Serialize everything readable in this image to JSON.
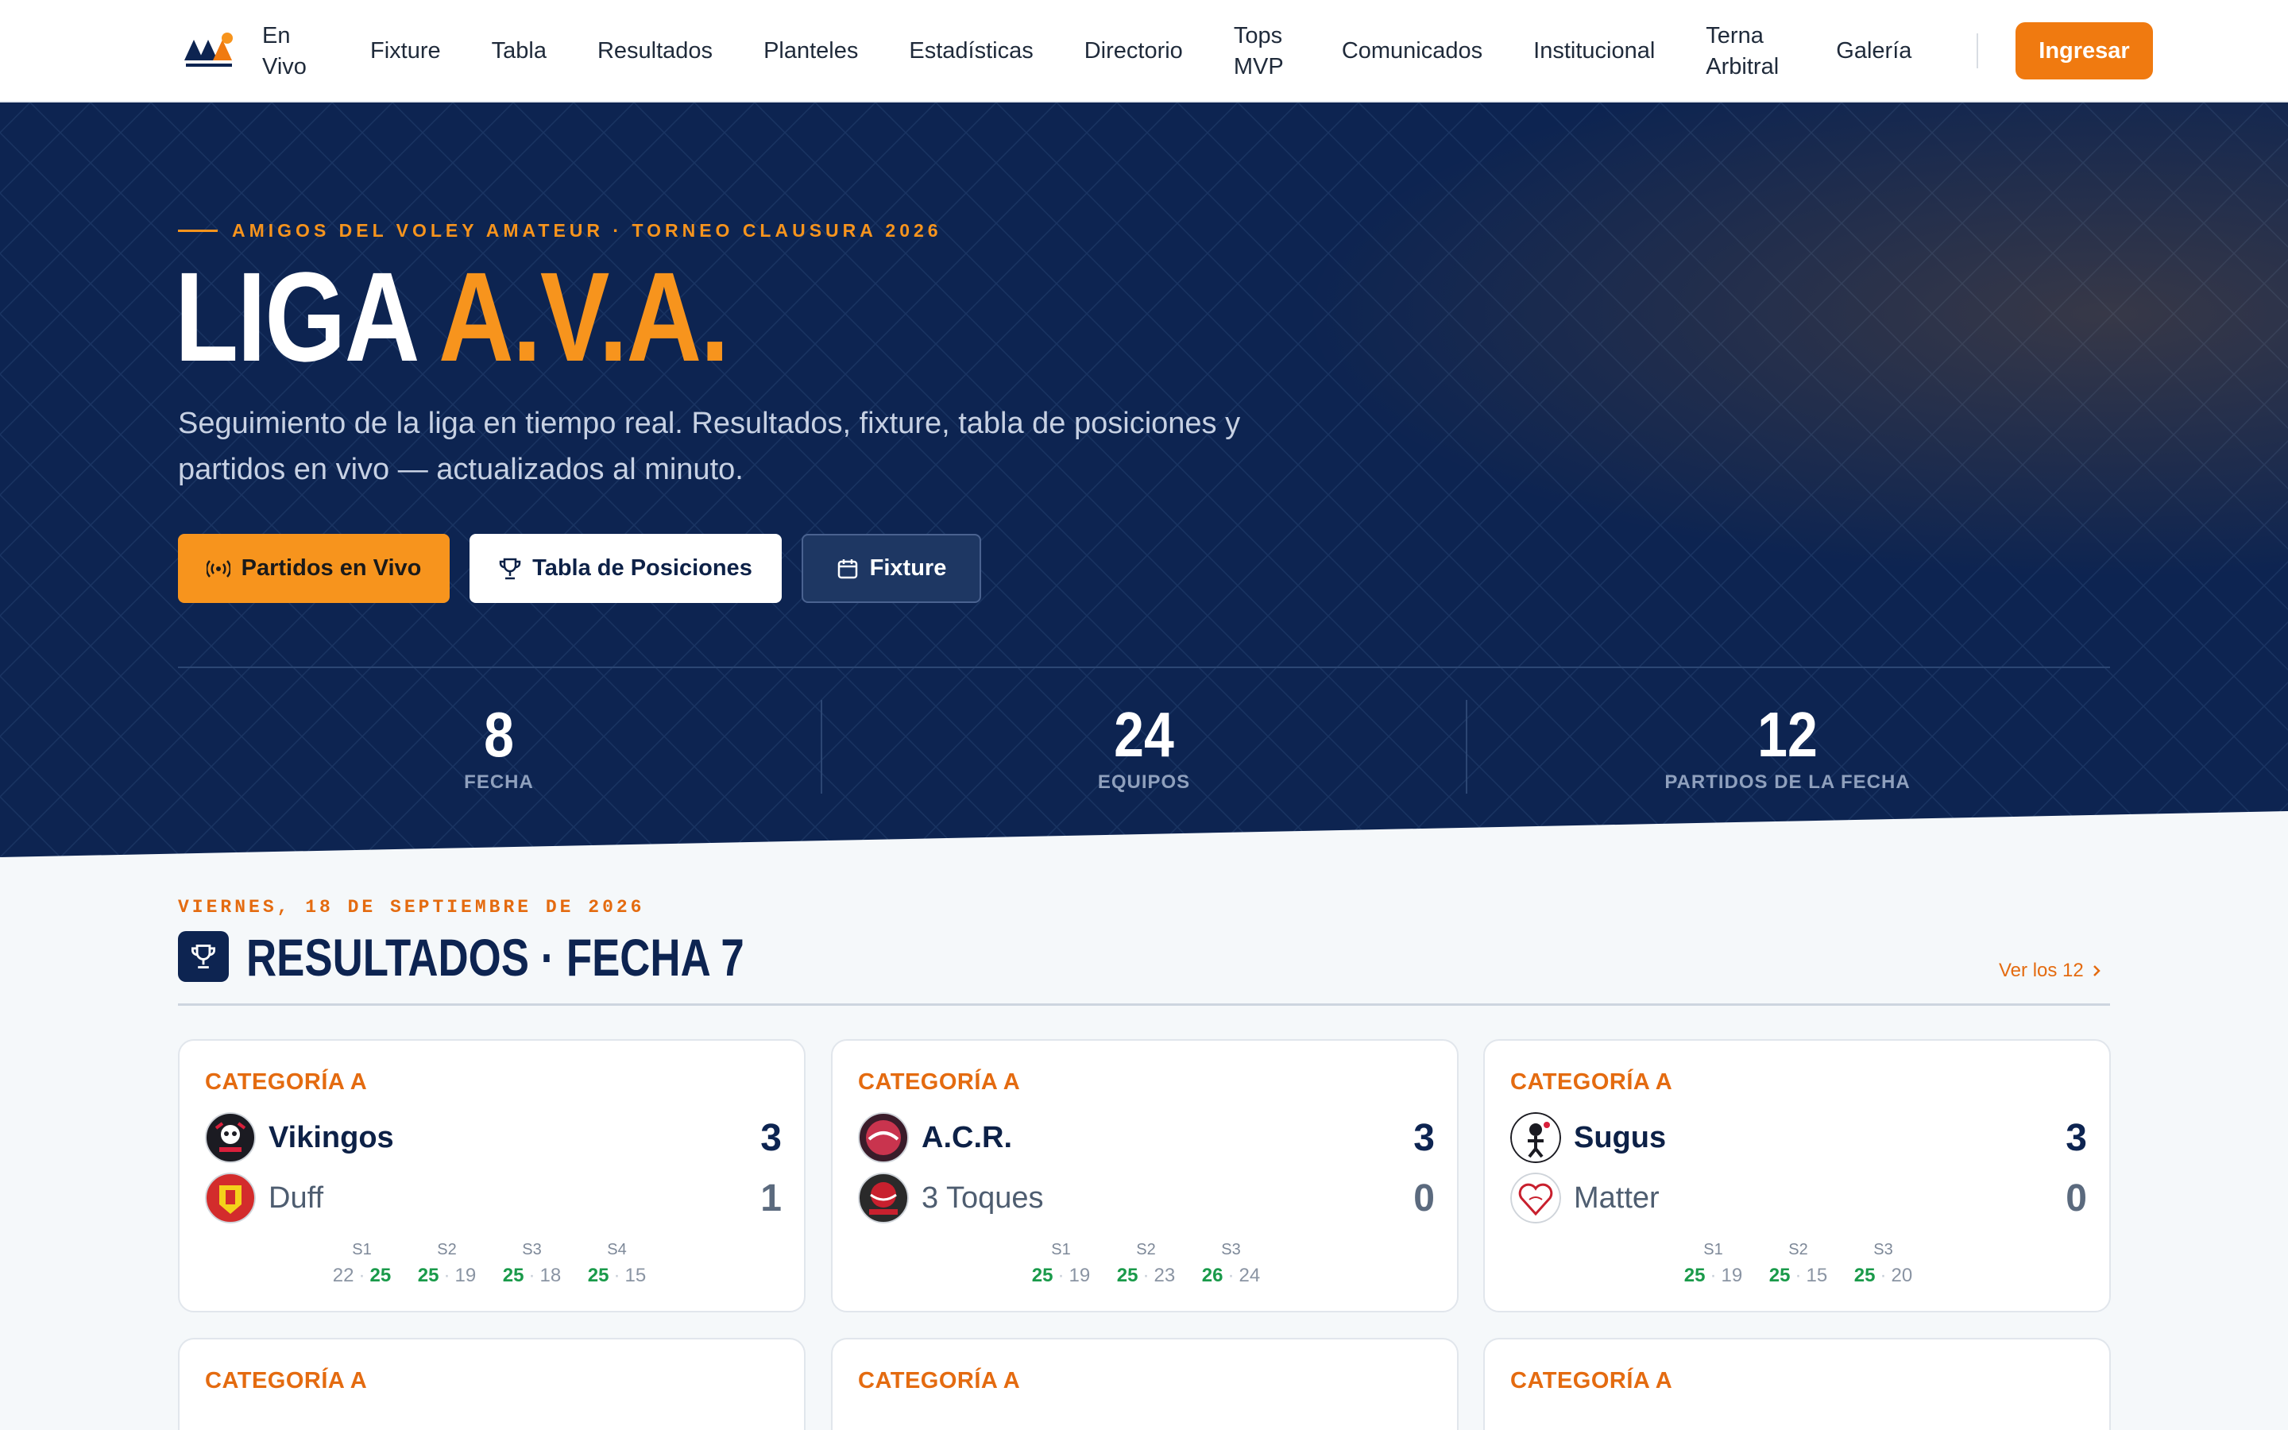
{
  "nav": {
    "items": [
      "En\nVivo",
      "Fixture",
      "Tabla",
      "Resultados",
      "Planteles",
      "Estadísticas",
      "Directorio",
      "Tops\nMVP",
      "Comunicados",
      "Institucional",
      "Terna\nArbitral",
      "Galería"
    ],
    "login_label": "Ingresar"
  },
  "hero": {
    "eyebrow": "AMIGOS DEL VOLEY AMATEUR · TORNEO CLAUSURA 2026",
    "title_white": "LIGA",
    "title_orange": "A.V.A.",
    "subtitle": "Seguimiento de la liga en tiempo real. Resultados, fixture, tabla de posiciones y partidos en vivo — actualizados al minuto.",
    "buttons": {
      "live": "Partidos en Vivo",
      "table": "Tabla de Posiciones",
      "fixture": "Fixture"
    },
    "stats": [
      {
        "value": "8",
        "label": "FECHA"
      },
      {
        "value": "24",
        "label": "EQUIPOS"
      },
      {
        "value": "12",
        "label": "PARTIDOS DE LA FECHA"
      }
    ]
  },
  "results": {
    "date": "VIERNES, 18 DE SEPTIEMBRE DE 2026",
    "title": "RESULTADOS · FECHA 7",
    "see_all": "Ver los 12",
    "set_labels": [
      "S1",
      "S2",
      "S3",
      "S4"
    ],
    "matches": [
      {
        "category": "CATEGORÍA A",
        "home": {
          "name": "Vikingos",
          "score": "3"
        },
        "away": {
          "name": "Duff",
          "score": "1"
        },
        "sets": [
          [
            "22",
            "25"
          ],
          [
            "25",
            "19"
          ],
          [
            "25",
            "18"
          ],
          [
            "25",
            "15"
          ]
        ]
      },
      {
        "category": "CATEGORÍA A",
        "home": {
          "name": "A.C.R.",
          "score": "3"
        },
        "away": {
          "name": "3 Toques",
          "score": "0"
        },
        "sets": [
          [
            "25",
            "19"
          ],
          [
            "25",
            "23"
          ],
          [
            "26",
            "24"
          ]
        ]
      },
      {
        "category": "CATEGORÍA A",
        "home": {
          "name": "Sugus",
          "score": "3"
        },
        "away": {
          "name": "Matter",
          "score": "0"
        },
        "sets": [
          [
            "25",
            "19"
          ],
          [
            "25",
            "15"
          ],
          [
            "25",
            "20"
          ]
        ]
      },
      {
        "category": "CATEGORÍA A"
      },
      {
        "category": "CATEGORÍA A"
      },
      {
        "category": "CATEGORÍA A"
      }
    ]
  },
  "colors": {
    "navy": "#0d2451",
    "orange": "#f7941d",
    "accent_orange": "#e46b10",
    "win_green": "#1a9a4a"
  }
}
